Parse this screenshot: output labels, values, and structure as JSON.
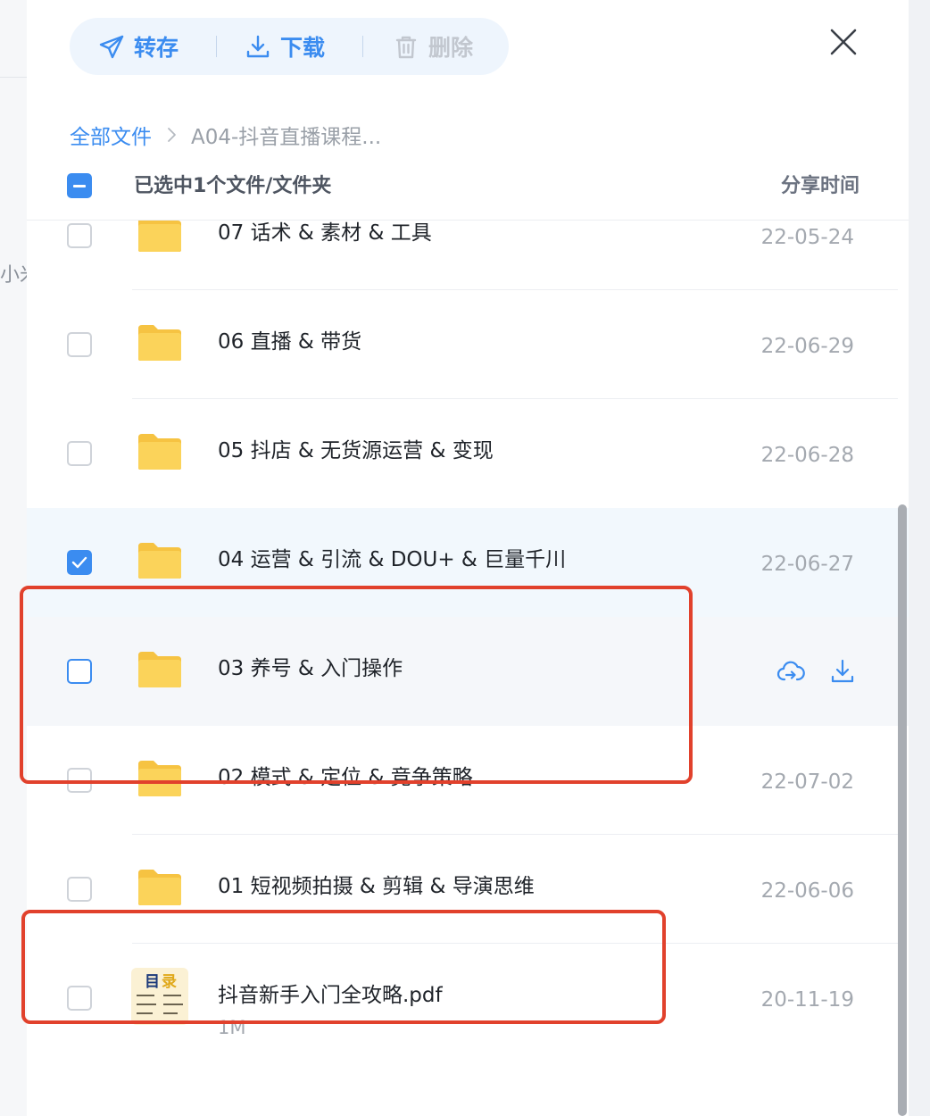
{
  "left_edge": {
    "partial_text": "小米"
  },
  "toolbar": {
    "transfer_label": "转存",
    "download_label": "下载",
    "delete_label": "删除"
  },
  "breadcrumb": {
    "root": "全部文件",
    "current": "A04-抖音直播课程..."
  },
  "list_header": {
    "selection_text": "已选中1个文件/文件夹",
    "column_time": "分享时间"
  },
  "files": [
    {
      "name": "",
      "date": "",
      "type": "folder",
      "checked": false
    },
    {
      "name": "07 话术 & 素材 & 工具",
      "date": "22-05-24",
      "type": "folder",
      "checked": false
    },
    {
      "name": "06 直播 & 带货",
      "date": "22-06-29",
      "type": "folder",
      "checked": false
    },
    {
      "name": "05 抖店 & 无货源运营 & 变现",
      "date": "22-06-28",
      "type": "folder",
      "checked": false
    },
    {
      "name": "04 运营 & 引流 & DOU+ & 巨量千川",
      "date": "22-06-27",
      "type": "folder",
      "checked": true
    },
    {
      "name": "03 养号 & 入门操作",
      "date": "",
      "type": "folder",
      "checked": false,
      "hovered": true
    },
    {
      "name": "02 模式 & 定位 & 竞争策略",
      "date": "22-07-02",
      "type": "folder",
      "checked": false
    },
    {
      "name": "01 短视频拍摄 & 剪辑 & 导演思维",
      "date": "22-06-06",
      "type": "folder",
      "checked": false
    },
    {
      "name": "抖音新手入门全攻略.pdf",
      "date": "20-11-19",
      "size": "1M",
      "type": "pdf",
      "checked": false
    }
  ],
  "pdf_thumbnail": {
    "title_1": "目",
    "title_2": "录"
  },
  "colors": {
    "accent": "#3b8cf0",
    "highlight_box": "#e1412c",
    "folder_yellow": "#fbd35a",
    "selected_row_bg": "#f2f8fd"
  }
}
